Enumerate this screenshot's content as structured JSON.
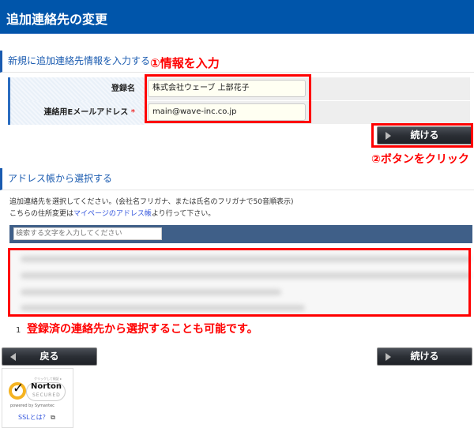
{
  "header": {
    "title": "追加連絡先の変更"
  },
  "new_section": {
    "title": "新規に追加連絡先情報を入力する",
    "annotation": "①情報を入力",
    "fields": [
      {
        "label": "登録名",
        "value": "株式会社ウェーブ 上部花子",
        "required": false
      },
      {
        "label": "連絡用Eメールアドレス",
        "value": "main@wave-inc.co.jp",
        "required": true,
        "required_mark": "*"
      }
    ],
    "continue_label": "続ける",
    "button_annotation": "②ボタンをクリック"
  },
  "address_section": {
    "title": "アドレス帳から選択する",
    "description": "追加連絡先を選択してください。(会社名フリガナ、または氏名のフリガナで50音順表示)",
    "change_prefix": "こちらの住所変更は",
    "change_link": "マイページのアドレス帳",
    "change_suffix": "より行って下さい。",
    "search_placeholder": "検索する文字を入力してください",
    "page_number": "1",
    "annotation": "登録済の連絡先から選択することも可能です。"
  },
  "footer": {
    "back_label": "戻る",
    "continue_label": "続ける",
    "badge": {
      "brand": "Norton",
      "secured": "SECURED",
      "powered": "powered by Symantec",
      "small": "クリックして検証 ▸"
    },
    "ssl_link": "SSLとは？"
  },
  "colors": {
    "header": "#0055aa",
    "accent": "#1a5bb0",
    "annotation": "#ff0000",
    "search_bar": "#3f5f88"
  }
}
